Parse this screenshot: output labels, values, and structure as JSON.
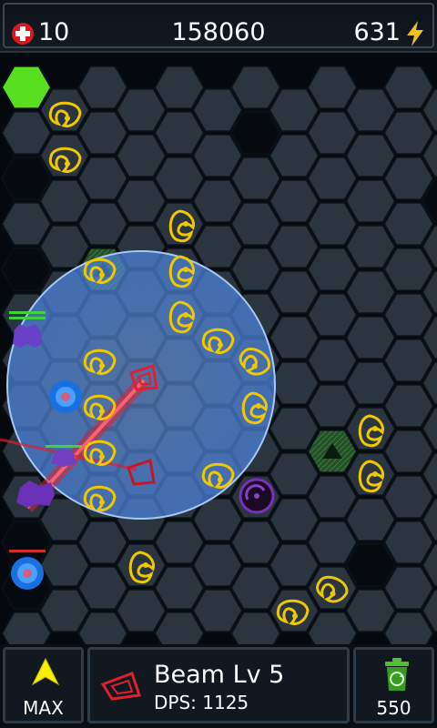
{
  "hud": {
    "lives": "10",
    "score": "158060",
    "energy": "631"
  },
  "icons": {
    "lives": "medical-cross-icon",
    "energy": "lightning-bolt-icon",
    "upgrade": "arrow-up-icon",
    "sell": "recycle-bin-icon",
    "tower": "beam-tower-icon"
  },
  "colors": {
    "grid_cell": "#2a353f",
    "blocked_cell": "#24552a",
    "start_cell": "#58e020",
    "exit_cell": "#e01010",
    "range_circle": "#5a90e0",
    "tower_gold": "#f0c800",
    "beam": "#e02030",
    "energy_bolt": "#f0c020",
    "upgrade_arrow": "#f8f000",
    "recycle_green": "#50c030"
  },
  "controls": {
    "upgrade_label": "MAX",
    "tower_name": "Beam Lv 5",
    "tower_dps": "DPS: 1125",
    "sell_value": "550"
  }
}
